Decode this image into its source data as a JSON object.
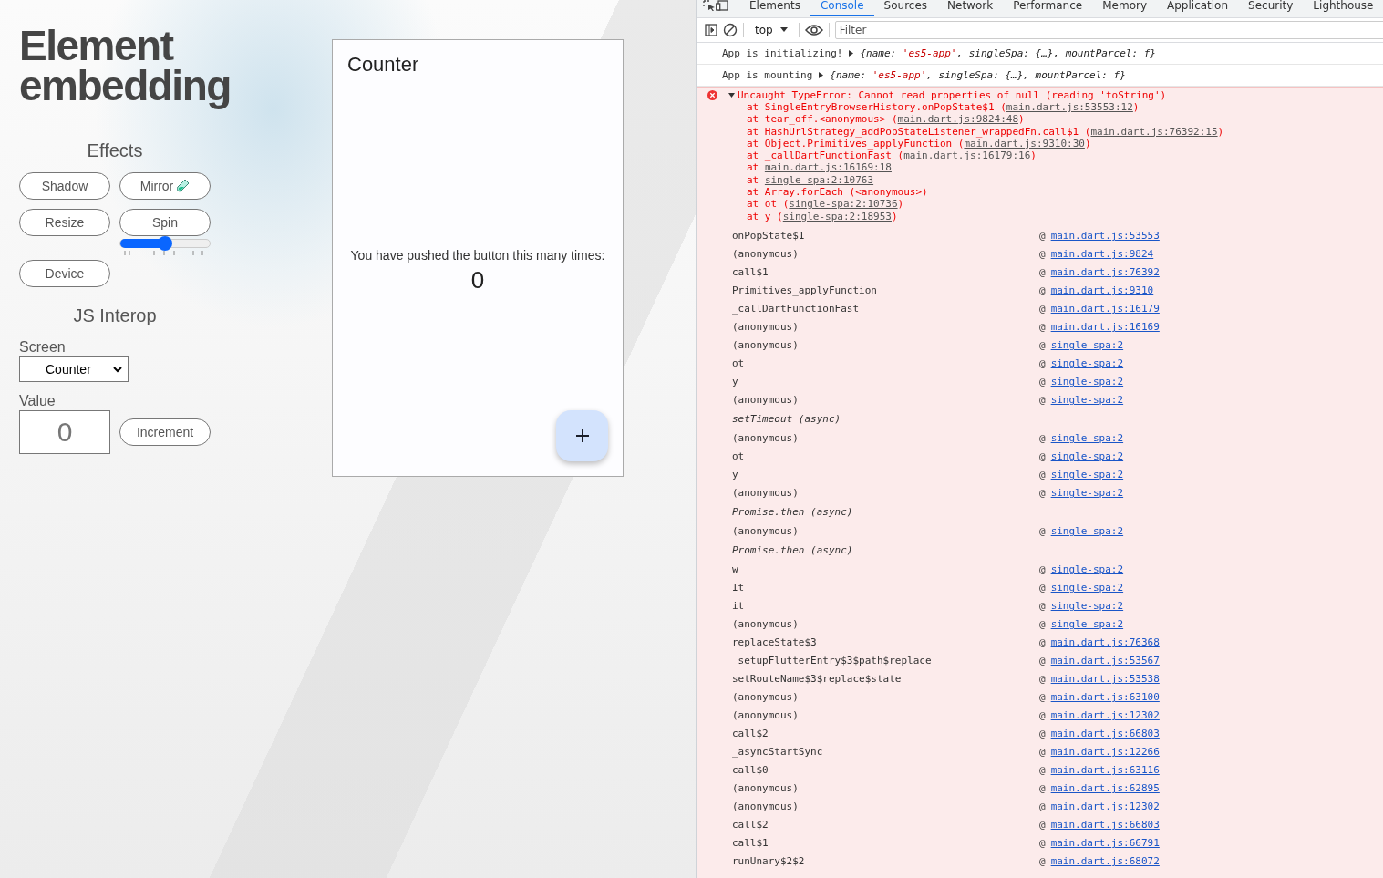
{
  "page": {
    "title": "Element embedding",
    "effects": {
      "heading": "Effects",
      "buttons": [
        {
          "label": "Shadow",
          "kind": "plain"
        },
        {
          "label": "Mirror",
          "kind": "tube"
        },
        {
          "label": "Resize",
          "kind": "plain"
        },
        {
          "label": "Spin",
          "kind": "plain"
        },
        {
          "label": "Device",
          "kind": "plain"
        }
      ],
      "spin_slider": {
        "level": 0.5
      }
    },
    "interop": {
      "heading": "JS Interop",
      "screen_label": "Screen",
      "screen_value": "Counter",
      "value_label": "Value",
      "value": "0",
      "increment": "Increment"
    }
  },
  "counter_app": {
    "title": "Counter",
    "message": "You have pushed the button this many times:",
    "count": "0"
  },
  "devtools": {
    "tabs": [
      {
        "label": "Elements",
        "selected": false
      },
      {
        "label": "Console",
        "selected": true
      },
      {
        "label": "Sources",
        "selected": false
      },
      {
        "label": "Network",
        "selected": false
      },
      {
        "label": "Performance",
        "selected": false
      },
      {
        "label": "Memory",
        "selected": false
      },
      {
        "label": "Application",
        "selected": false
      },
      {
        "label": "Security",
        "selected": false
      },
      {
        "label": "Lighthouse",
        "selected": false
      }
    ],
    "context": "top",
    "filter_placeholder": "Filter",
    "messages": [
      {
        "text": "App is initializing!",
        "preview": [
          {
            "t": "{name: "
          },
          {
            "t": "'es5-app'",
            "kind": "string"
          },
          {
            "t": ", singleSpa: {…}, mountParcel: f}"
          }
        ]
      },
      {
        "text": "App is mounting",
        "preview": [
          {
            "t": "{name: "
          },
          {
            "t": "'es5-app'",
            "kind": "string"
          },
          {
            "t": ", singleSpa: {…}, mountParcel: f}"
          }
        ]
      }
    ],
    "error": {
      "message": "Uncaught TypeError: Cannot read properties of null (reading 'toString')",
      "expanded": true,
      "stack": [
        [
          {
            "t": "at SingleEntryBrowserHistory.onPopState$1 ("
          },
          {
            "t": "main.dart.js:53553:12",
            "kind": "link"
          },
          {
            "t": ")"
          }
        ],
        [
          {
            "t": "at tear_off.<anonymous> ("
          },
          {
            "t": "main.dart.js:9824:48",
            "kind": "link"
          },
          {
            "t": ")"
          }
        ],
        [
          {
            "t": "at HashUrlStrategy_addPopStateListener_wrappedFn.call$1 ("
          },
          {
            "t": "main.dart.js:76392:15",
            "kind": "link"
          },
          {
            "t": ")"
          }
        ],
        [
          {
            "t": "at Object.Primitives_applyFunction ("
          },
          {
            "t": "main.dart.js:9310:30",
            "kind": "link"
          },
          {
            "t": ")"
          }
        ],
        [
          {
            "t": "at _callDartFunctionFast ("
          },
          {
            "t": "main.dart.js:16179:16",
            "kind": "link"
          },
          {
            "t": ")"
          }
        ],
        [
          {
            "t": "at "
          },
          {
            "t": "main.dart.js:16169:18",
            "kind": "link"
          }
        ],
        [
          {
            "t": "at "
          },
          {
            "t": "single-spa:2:10763",
            "kind": "link"
          }
        ],
        [
          {
            "t": "at Array.forEach (<anonymous>)"
          }
        ],
        [
          {
            "t": "at ot ("
          },
          {
            "t": "single-spa:2:10736",
            "kind": "link"
          },
          {
            "t": ")"
          }
        ],
        [
          {
            "t": "at y ("
          },
          {
            "t": "single-spa:2:18953",
            "kind": "link"
          },
          {
            "t": ")"
          }
        ]
      ],
      "frames": [
        {
          "kind": "frame",
          "name": "onPopState$1",
          "at": "@",
          "link": "main.dart.js:53553"
        },
        {
          "kind": "frame",
          "name": "(anonymous)",
          "at": "@",
          "link": "main.dart.js:9824"
        },
        {
          "kind": "frame",
          "name": "call$1",
          "at": "@",
          "link": "main.dart.js:76392"
        },
        {
          "kind": "frame",
          "name": "Primitives_applyFunction",
          "at": "@",
          "link": "main.dart.js:9310"
        },
        {
          "kind": "frame",
          "name": "_callDartFunctionFast",
          "at": "@",
          "link": "main.dart.js:16179"
        },
        {
          "kind": "frame",
          "name": "(anonymous)",
          "at": "@",
          "link": "main.dart.js:16169"
        },
        {
          "kind": "frame",
          "name": "(anonymous)",
          "at": "@",
          "link": "single-spa:2"
        },
        {
          "kind": "frame",
          "name": "ot",
          "at": "@",
          "link": "single-spa:2"
        },
        {
          "kind": "frame",
          "name": "y",
          "at": "@",
          "link": "single-spa:2"
        },
        {
          "kind": "frame",
          "name": "(anonymous)",
          "at": "@",
          "link": "single-spa:2"
        },
        {
          "kind": "async",
          "name": "setTimeout (async)"
        },
        {
          "kind": "frame",
          "name": "(anonymous)",
          "at": "@",
          "link": "single-spa:2"
        },
        {
          "kind": "frame",
          "name": "ot",
          "at": "@",
          "link": "single-spa:2"
        },
        {
          "kind": "frame",
          "name": "y",
          "at": "@",
          "link": "single-spa:2"
        },
        {
          "kind": "frame",
          "name": "(anonymous)",
          "at": "@",
          "link": "single-spa:2"
        },
        {
          "kind": "async",
          "name": "Promise.then (async)"
        },
        {
          "kind": "frame",
          "name": "(anonymous)",
          "at": "@",
          "link": "single-spa:2"
        },
        {
          "kind": "async",
          "name": "Promise.then (async)"
        },
        {
          "kind": "frame",
          "name": "w",
          "at": "@",
          "link": "single-spa:2"
        },
        {
          "kind": "frame",
          "name": "It",
          "at": "@",
          "link": "single-spa:2"
        },
        {
          "kind": "frame",
          "name": "it",
          "at": "@",
          "link": "single-spa:2"
        },
        {
          "kind": "frame",
          "name": "(anonymous)",
          "at": "@",
          "link": "single-spa:2"
        },
        {
          "kind": "frame",
          "name": "replaceState$3",
          "at": "@",
          "link": "main.dart.js:76368"
        },
        {
          "kind": "frame",
          "name": "_setupFlutterEntry$3$path$replace",
          "at": "@",
          "link": "main.dart.js:53567"
        },
        {
          "kind": "frame",
          "name": "setRouteName$3$replace$state",
          "at": "@",
          "link": "main.dart.js:53538"
        },
        {
          "kind": "frame",
          "name": "(anonymous)",
          "at": "@",
          "link": "main.dart.js:63100"
        },
        {
          "kind": "frame",
          "name": "(anonymous)",
          "at": "@",
          "link": "main.dart.js:12302"
        },
        {
          "kind": "frame",
          "name": "call$2",
          "at": "@",
          "link": "main.dart.js:66803"
        },
        {
          "kind": "frame",
          "name": "_asyncStartSync",
          "at": "@",
          "link": "main.dart.js:12266"
        },
        {
          "kind": "frame",
          "name": "call$0",
          "at": "@",
          "link": "main.dart.js:63116"
        },
        {
          "kind": "frame",
          "name": "(anonymous)",
          "at": "@",
          "link": "main.dart.js:62895"
        },
        {
          "kind": "frame",
          "name": "(anonymous)",
          "at": "@",
          "link": "main.dart.js:12302"
        },
        {
          "kind": "frame",
          "name": "call$2",
          "at": "@",
          "link": "main.dart.js:66803"
        },
        {
          "kind": "frame",
          "name": "call$1",
          "at": "@",
          "link": "main.dart.js:66791"
        },
        {
          "kind": "frame",
          "name": "runUnary$2$2",
          "at": "@",
          "link": "main.dart.js:68072"
        }
      ]
    }
  }
}
